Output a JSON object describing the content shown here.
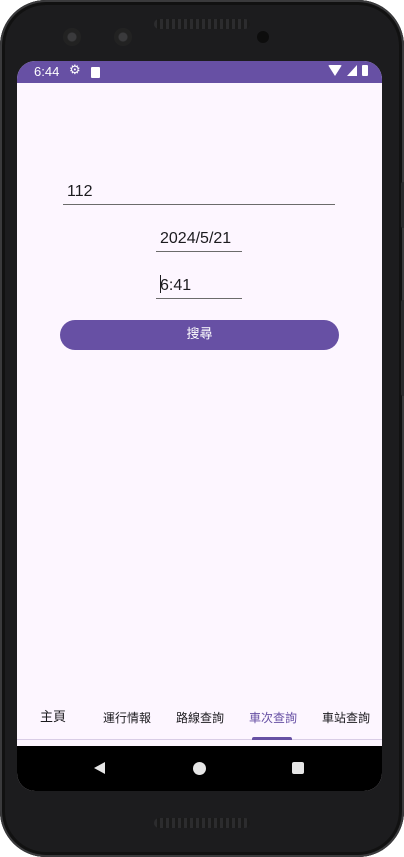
{
  "status_bar": {
    "time": "6:44",
    "icons": [
      "gear-icon",
      "sd-card-icon",
      "wifi-icon",
      "signal-icon",
      "battery-icon"
    ]
  },
  "form": {
    "train_number": "112",
    "date": "2024/5/21",
    "time": "6:41",
    "search_label": "搜尋"
  },
  "bottom_nav": {
    "items": [
      {
        "label": "主頁"
      },
      {
        "label": "運行情報"
      },
      {
        "label": "路線查詢"
      },
      {
        "label": "車次查詢"
      },
      {
        "label": "車站查詢"
      }
    ],
    "active_index": 3
  },
  "colors": {
    "accent": "#6750a4",
    "background": "#fdf6ff"
  }
}
